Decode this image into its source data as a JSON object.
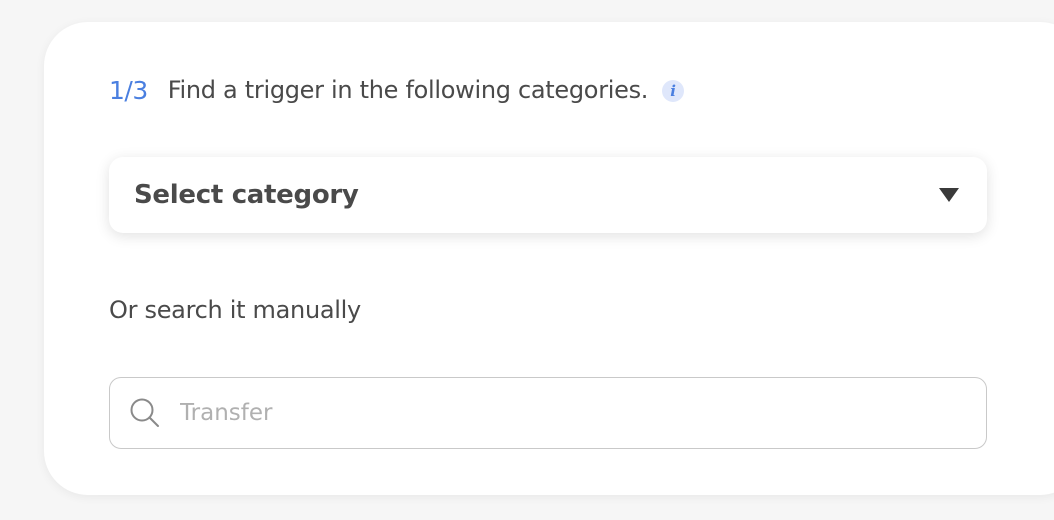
{
  "step": {
    "number": "1/3",
    "text": "Find a trigger in the following categories.",
    "info_glyph": "i"
  },
  "category_select": {
    "label": "Select category",
    "caret_icon": "triangle-down-icon"
  },
  "manual_search": {
    "label": "Or search it manually",
    "placeholder": "Transfer",
    "value": "",
    "icon": "search-icon"
  },
  "colors": {
    "accent": "#4a7fe0",
    "text": "#4a4a4a",
    "page_bg": "#f6f6f6",
    "card_bg": "#ffffff"
  }
}
